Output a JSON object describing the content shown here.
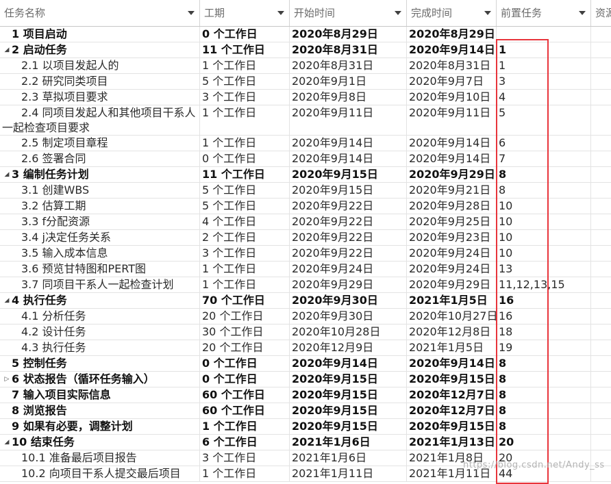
{
  "columns": [
    {
      "label": "任务名称"
    },
    {
      "label": "工期"
    },
    {
      "label": "开始时间"
    },
    {
      "label": "完成时间"
    },
    {
      "label": "前置任务"
    },
    {
      "label": "资源"
    }
  ],
  "rows": [
    {
      "name": "1 项目启动",
      "duration": "0 个工作日",
      "start": "2020年8月29日",
      "finish": "2020年8月29日",
      "pred": "",
      "summary": true,
      "expander": "",
      "indent": 0,
      "height": 23
    },
    {
      "name": "2 启动任务",
      "duration": "11 个工作日",
      "start": "2020年8月31日",
      "finish": "2020年9月14日",
      "pred": "1",
      "summary": true,
      "expander": "◢",
      "indent": 0,
      "height": 23
    },
    {
      "name": "2.1 以项目发起人的",
      "duration": "1 个工作日",
      "start": "2020年8月31日",
      "finish": "2020年8月31日",
      "pred": "1",
      "summary": false,
      "expander": "",
      "indent": 1,
      "height": 23
    },
    {
      "name": "2.2 研究同类项目",
      "duration": "5 个工作日",
      "start": "2020年9月1日",
      "finish": "2020年9月7日",
      "pred": "3",
      "summary": false,
      "expander": "",
      "indent": 1,
      "height": 23
    },
    {
      "name": "2.3 草拟项目要求",
      "duration": "3 个工作日",
      "start": "2020年9月8日",
      "finish": "2020年9月10日",
      "pred": "4",
      "summary": false,
      "expander": "",
      "indent": 1,
      "height": 23
    },
    {
      "name": "2.4 同项目发起人和其他项目干系人一起检查项目要求",
      "duration": "1 个工作日",
      "start": "2020年9月11日",
      "finish": "2020年9月11日",
      "pred": "5",
      "summary": false,
      "expander": "",
      "indent": 1,
      "height": 44
    },
    {
      "name": "2.5 制定项目章程",
      "duration": "1 个工作日",
      "start": "2020年9月14日",
      "finish": "2020年9月14日",
      "pred": "6",
      "summary": false,
      "expander": "",
      "indent": 1,
      "height": 23
    },
    {
      "name": "2.6 签署合同",
      "duration": "0 个工作日",
      "start": "2020年9月14日",
      "finish": "2020年9月14日",
      "pred": "7",
      "summary": false,
      "expander": "",
      "indent": 1,
      "height": 23
    },
    {
      "name": "3 编制任务计划",
      "duration": "11 个工作日",
      "start": "2020年9月15日",
      "finish": "2020年9月29日",
      "pred": "8",
      "summary": true,
      "expander": "◢",
      "indent": 0,
      "height": 23
    },
    {
      "name": "3.1 创建WBS",
      "duration": "5 个工作日",
      "start": "2020年9月15日",
      "finish": "2020年9月21日",
      "pred": "8",
      "summary": false,
      "expander": "",
      "indent": 1,
      "height": 23
    },
    {
      "name": "3.2 估算工期",
      "duration": "5 个工作日",
      "start": "2020年9月22日",
      "finish": "2020年9月28日",
      "pred": "10",
      "summary": false,
      "expander": "",
      "indent": 1,
      "height": 23
    },
    {
      "name": "3.3 f分配资源",
      "duration": "4 个工作日",
      "start": "2020年9月22日",
      "finish": "2020年9月25日",
      "pred": "10",
      "summary": false,
      "expander": "",
      "indent": 1,
      "height": 23
    },
    {
      "name": "3.4 j决定任务关系",
      "duration": "2 个工作日",
      "start": "2020年9月22日",
      "finish": "2020年9月23日",
      "pred": "10",
      "summary": false,
      "expander": "",
      "indent": 1,
      "height": 23
    },
    {
      "name": "3.5 输入成本信息",
      "duration": "3 个工作日",
      "start": "2020年9月22日",
      "finish": "2020年9月24日",
      "pred": "10",
      "summary": false,
      "expander": "",
      "indent": 1,
      "height": 23
    },
    {
      "name": "3.6 预览甘特图和PERT图",
      "duration": "1 个工作日",
      "start": "2020年9月24日",
      "finish": "2020年9月24日",
      "pred": "13",
      "summary": false,
      "expander": "",
      "indent": 1,
      "height": 23
    },
    {
      "name": "3.7 同项目干系人一起检查计划",
      "duration": "1 个工作日",
      "start": "2020年9月29日",
      "finish": "2020年9月29日",
      "pred": "11,12,13,15",
      "summary": false,
      "expander": "",
      "indent": 1,
      "height": 23
    },
    {
      "name": "4 执行任务",
      "duration": "70 个工作日",
      "start": "2020年9月30日",
      "finish": "2021年1月5日",
      "pred": "16",
      "summary": true,
      "expander": "◢",
      "indent": 0,
      "height": 23
    },
    {
      "name": "4.1 分析任务",
      "duration": "20 个工作日",
      "start": "2020年9月30日",
      "finish": "2020年10月27日",
      "pred": "16",
      "summary": false,
      "expander": "",
      "indent": 1,
      "height": 23
    },
    {
      "name": "4.2 设计任务",
      "duration": "30 个工作日",
      "start": "2020年10月28日",
      "finish": "2020年12月8日",
      "pred": "18",
      "summary": false,
      "expander": "",
      "indent": 1,
      "height": 23
    },
    {
      "name": "4.3 执行任务",
      "duration": "20 个工作日",
      "start": "2020年12月9日",
      "finish": "2021年1月5日",
      "pred": "19",
      "summary": false,
      "expander": "",
      "indent": 1,
      "height": 23
    },
    {
      "name": "5 控制任务",
      "duration": "0 个工作日",
      "start": "2020年9月14日",
      "finish": "2020年9月14日",
      "pred": "8",
      "summary": true,
      "expander": "",
      "indent": 0,
      "height": 23
    },
    {
      "name": "6 状态报告（循环任务输入）",
      "duration": "0 个工作日",
      "start": "2020年9月15日",
      "finish": "2020年9月15日",
      "pred": "8",
      "summary": true,
      "expander": "▷",
      "indent": 0,
      "height": 23
    },
    {
      "name": "7 输入项目实际信息",
      "duration": "60 个工作日",
      "start": "2020年9月15日",
      "finish": "2020年12月7日",
      "pred": "8",
      "summary": true,
      "expander": "",
      "indent": 0,
      "height": 23
    },
    {
      "name": "8 浏览报告",
      "duration": "60 个工作日",
      "start": "2020年9月15日",
      "finish": "2020年12月7日",
      "pred": "8",
      "summary": true,
      "expander": "",
      "indent": 0,
      "height": 23
    },
    {
      "name": "9 如果有必要，调整计划",
      "duration": "1 个工作日",
      "start": "2020年9月15日",
      "finish": "2020年9月15日",
      "pred": "8",
      "summary": true,
      "expander": "",
      "indent": 0,
      "height": 23
    },
    {
      "name": "10 结束任务",
      "duration": "6 个工作日",
      "start": "2021年1月6日",
      "finish": "2021年1月13日",
      "pred": "20",
      "summary": true,
      "expander": "◢",
      "indent": 0,
      "height": 23
    },
    {
      "name": "10.1 准备最后项目报告",
      "duration": "3 个工作日",
      "start": "2021年1月6日",
      "finish": "2021年1月8日",
      "pred": "20",
      "summary": false,
      "expander": "",
      "indent": 1,
      "height": 23
    },
    {
      "name": "10.2 向项目干系人提交最后项目",
      "duration": "1 个工作日",
      "start": "2021年1月11日",
      "finish": "2021年1月11日",
      "pred": "44",
      "summary": false,
      "expander": "",
      "indent": 1,
      "height": 23
    }
  ],
  "watermark": "https://blog.csdn.net/Andy_ss",
  "colors": {
    "highlight": "#e8343b",
    "header_text": "#6b6b6b",
    "grid_line": "#e3e3e3"
  }
}
